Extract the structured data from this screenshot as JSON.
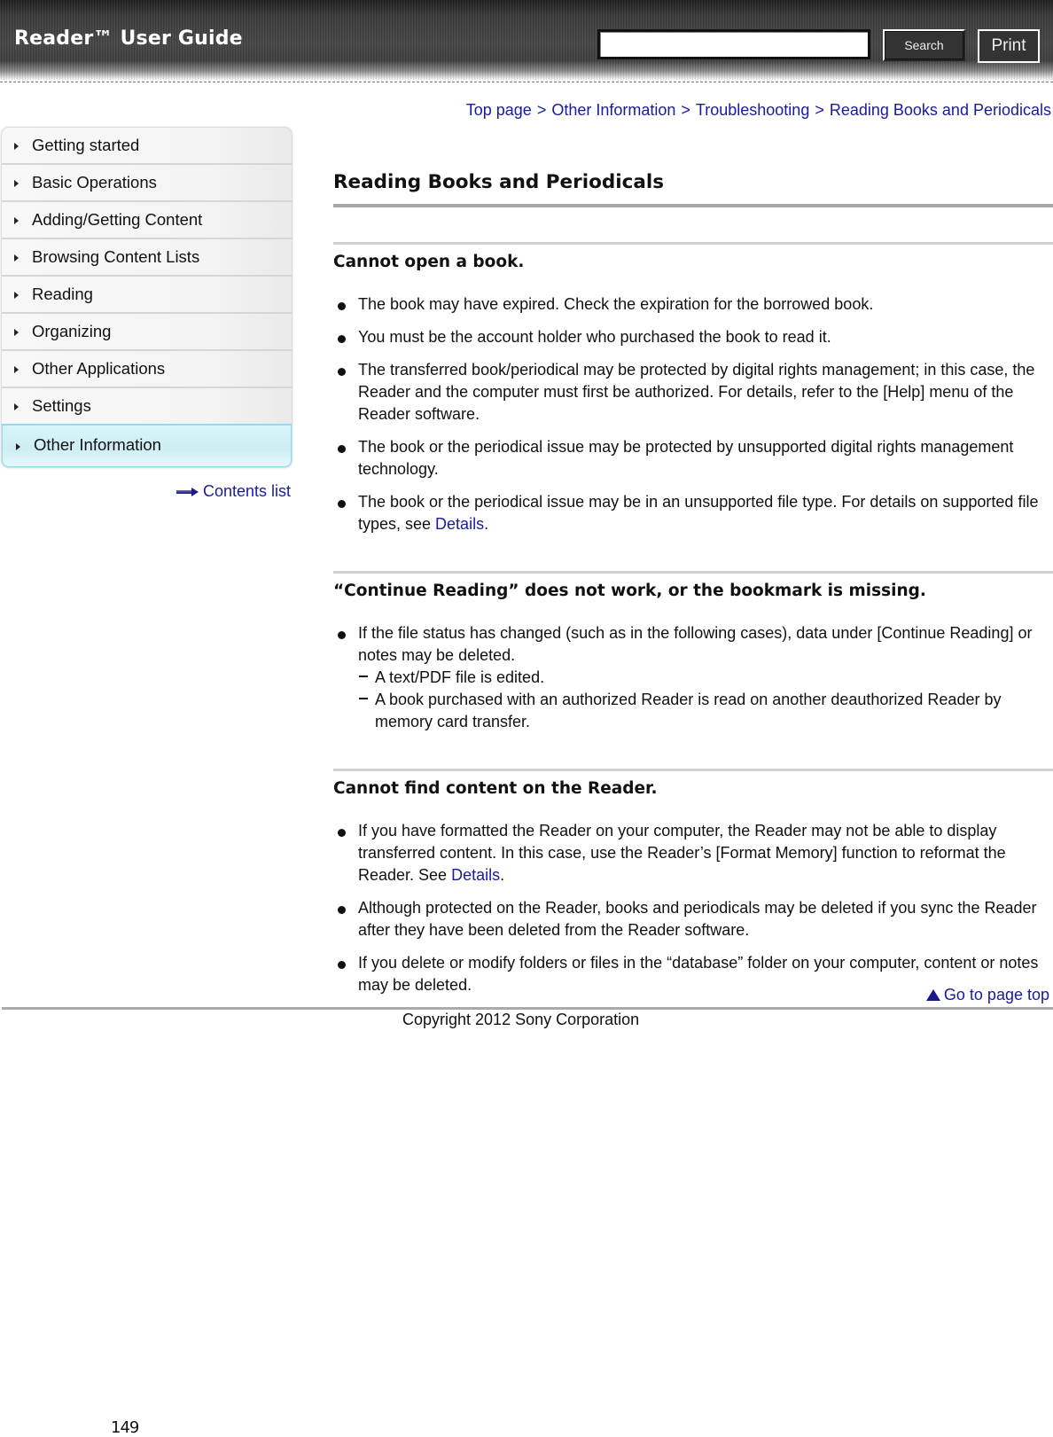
{
  "header": {
    "title": "Reader™ User Guide",
    "search_placeholder": "",
    "search_value": "",
    "search_label": "Search",
    "print_label": "Print"
  },
  "breadcrumb": {
    "items": [
      "Top page",
      "Other Information",
      "Troubleshooting",
      "Reading Books and Periodicals"
    ],
    "separator": ">"
  },
  "sidebar": {
    "items": [
      {
        "label": "Getting started",
        "active": false
      },
      {
        "label": "Basic Operations",
        "active": false
      },
      {
        "label": "Adding/Getting Content",
        "active": false
      },
      {
        "label": "Browsing Content Lists",
        "active": false
      },
      {
        "label": "Reading",
        "active": false
      },
      {
        "label": "Organizing",
        "active": false
      },
      {
        "label": "Other Applications",
        "active": false
      },
      {
        "label": "Settings",
        "active": false
      },
      {
        "label": "Other Information",
        "active": true
      }
    ],
    "contents_list_label": "Contents list"
  },
  "main": {
    "title": "Reading Books and Periodicals",
    "sections": [
      {
        "heading": "Cannot open a book.",
        "bullets": [
          {
            "text": "The book may have expired. Check the expiration for the borrowed book."
          },
          {
            "text": "You must be the account holder who purchased the book to read it."
          },
          {
            "text": "The transferred book/periodical may be protected by digital rights management; in this case, the Reader and the computer must first be authorized. For details, refer to the [Help] menu of the Reader software."
          },
          {
            "text": "The book or the periodical issue may be protected by unsupported digital rights management technology."
          },
          {
            "text": "The book or the periodical issue may be in an unsupported file type. For details on supported file types, see ",
            "link": "Details",
            "after": "."
          }
        ]
      },
      {
        "heading": "“Continue Reading” does not work, or the bookmark is missing.",
        "bullets": [
          {
            "text": "If the file status has changed (such as in the following cases), data under [Continue Reading] or notes may be deleted.",
            "sub": [
              "A text/PDF file is edited.",
              "A book purchased with an authorized Reader is read on another deauthorized Reader by memory card transfer."
            ]
          }
        ]
      },
      {
        "heading": "Cannot find content on the Reader.",
        "bullets": [
          {
            "text": "If you have formatted the Reader on your computer, the Reader may not be able to display transferred content. In this case, use the Reader’s [Format Memory] function to reformat the Reader. See ",
            "link": "Details",
            "after": "."
          },
          {
            "text": "Although protected on the Reader, books and periodicals may be deleted if you sync the Reader after they have been deleted from the Reader software."
          },
          {
            "text": "If you delete or modify folders or files in the “database” folder on your computer, content or notes may be deleted."
          }
        ]
      }
    ]
  },
  "footer": {
    "go_top_label": "Go to page top",
    "copyright": "Copyright 2012 Sony Corporation",
    "page_number": "149"
  },
  "colors": {
    "link": "#1a1aa0",
    "active_nav_bg": "#d6f5fa",
    "active_nav_border": "#8fdcee",
    "header_bg": "#3d3d3d"
  }
}
